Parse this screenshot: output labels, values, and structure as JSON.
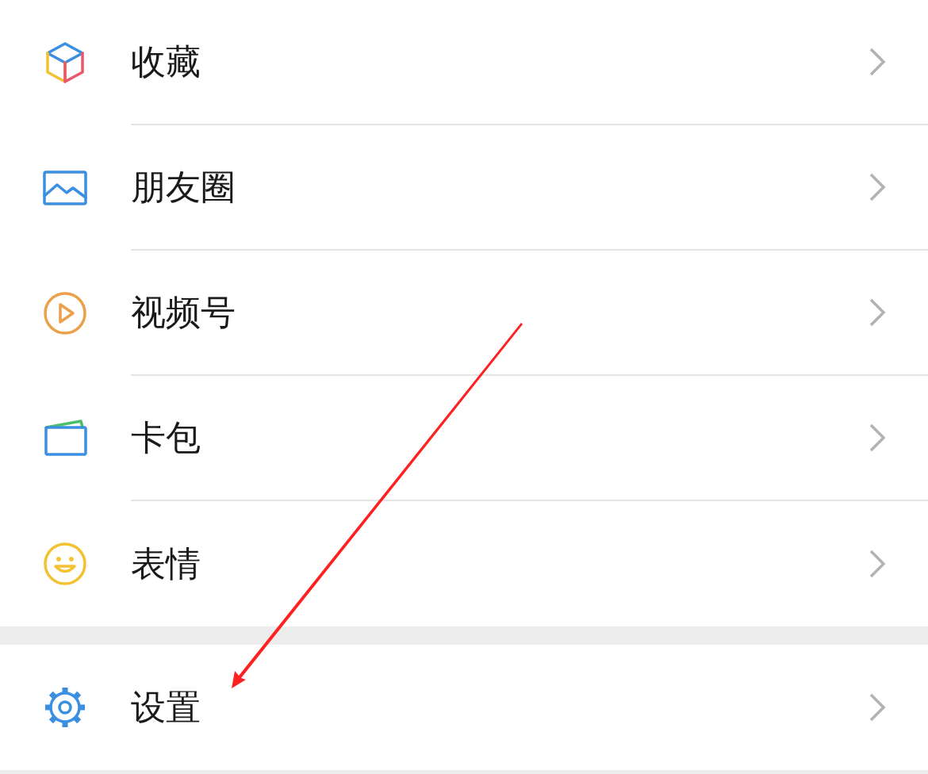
{
  "groups": [
    {
      "items": [
        {
          "label": "收藏",
          "kind": "favorites"
        },
        {
          "label": "朋友圈",
          "kind": "moments"
        },
        {
          "label": "视频号",
          "kind": "channels"
        },
        {
          "label": "卡包",
          "kind": "cards"
        },
        {
          "label": "表情",
          "kind": "stickers"
        }
      ]
    },
    {
      "items": [
        {
          "label": "设置",
          "kind": "settings"
        }
      ]
    }
  ]
}
